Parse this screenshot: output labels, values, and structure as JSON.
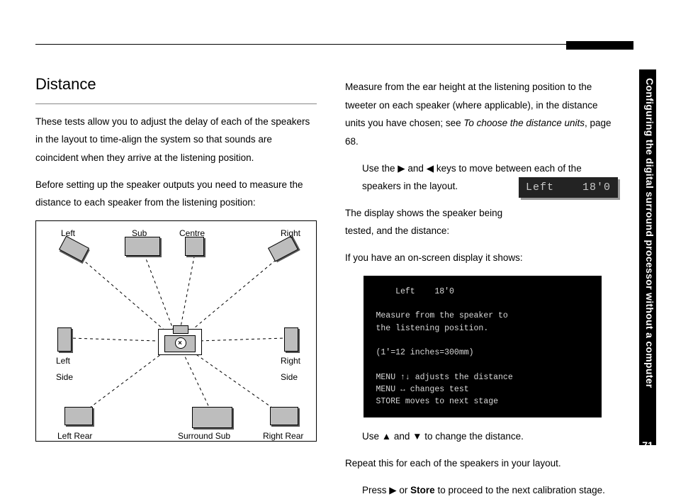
{
  "sidebar": {
    "section_title": "Configuring the digital surround processor without a computer",
    "page_number": "71"
  },
  "left_column": {
    "heading": "Distance",
    "para1": "These tests allow you to adjust the delay of each of the speakers in the layout to time-align the system so that sounds are coincident when they arrive at the listening position.",
    "para2": "Before setting up the speaker outputs you need to measure the distance to each speaker from the listening position:",
    "diagram_labels": {
      "left": "Left",
      "sub": "Sub",
      "centre": "Centre",
      "right": "Right",
      "left_side": "Left\nSide",
      "right_side": "Right\nSide",
      "left_rear": "Left Rear",
      "surround_sub": "Surround Sub",
      "right_rear": "Right Rear"
    }
  },
  "right_column": {
    "para1_a": "Measure from the ear height at the listening position to the tweeter on each speaker (where applicable), in the distance units you have chosen; see ",
    "para1_ref": "To choose the distance units",
    "para1_b": ", page 68.",
    "bullet1_a": "Use the ",
    "bullet1_arrows": "▶ and ◀",
    "bullet1_b": " keys to move between each of the speakers in the layout.",
    "para2": "The display shows the speaker being tested, and the distance:",
    "lcd_text": "Left    18'0",
    "para3": "If you have an on-screen display it shows:",
    "osd_text": "    Left    18'0\n\nMeasure from the speaker to\nthe listening position.\n\n(1'=12 inches=300mm)\n\nMENU ↑↓ adjusts the distance\nMENU ↔ changes test\nSTORE moves to next stage",
    "bullet2_a": "Use ",
    "bullet2_arrows": "▲ and ▼",
    "bullet2_b": " to change the distance.",
    "para4": "Repeat this for each of the speakers in your layout.",
    "bullet3_a": "Press ",
    "bullet3_arrow": "▶",
    "bullet3_b": " or ",
    "bullet3_store": "Store",
    "bullet3_c": " to proceed to the next calibration stage."
  }
}
